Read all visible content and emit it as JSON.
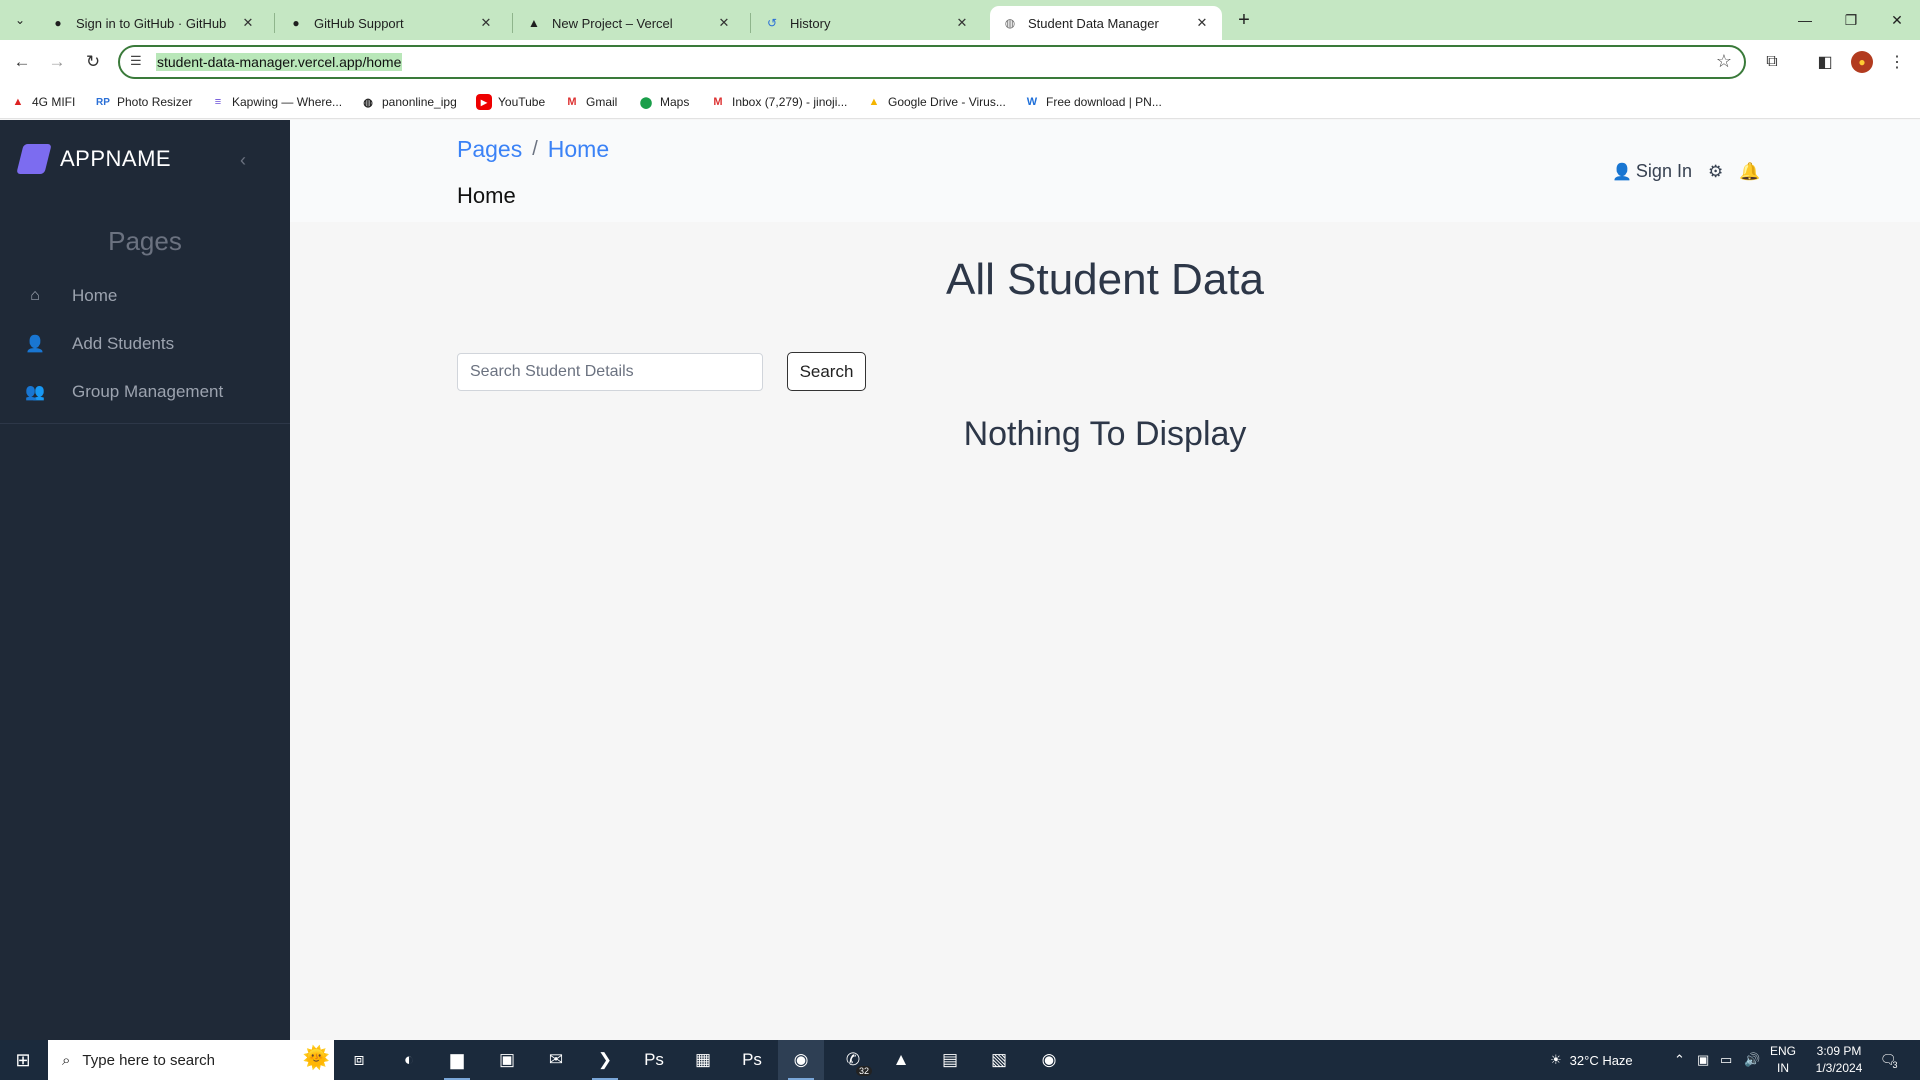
{
  "browser": {
    "tabs": [
      {
        "title": "Sign in to GitHub · GitHub",
        "icon": "github-icon"
      },
      {
        "title": "GitHub Support",
        "icon": "github-icon"
      },
      {
        "title": "New Project – Vercel",
        "icon": "vercel-icon"
      },
      {
        "title": "History",
        "icon": "history-icon"
      },
      {
        "title": "Student Data Manager",
        "icon": "globe-icon"
      }
    ],
    "active_tab": 4,
    "url": "student-data-manager.vercel.app/home",
    "bookmarks": [
      {
        "label": "4G MIFI"
      },
      {
        "label": "Photo Resizer"
      },
      {
        "label": "Kapwing — Where..."
      },
      {
        "label": "panonline_ipg"
      },
      {
        "label": "YouTube"
      },
      {
        "label": "Gmail"
      },
      {
        "label": "Maps"
      },
      {
        "label": "Inbox (7,279) - jinoji..."
      },
      {
        "label": "Google Drive - Virus..."
      },
      {
        "label": "Free download | PN..."
      }
    ]
  },
  "app": {
    "brand": "APPNAME",
    "sidebar": {
      "section_title": "Pages",
      "items": [
        {
          "label": "Home",
          "icon": "home-icon"
        },
        {
          "label": "Add Students",
          "icon": "add-user-icon"
        },
        {
          "label": "Group Management",
          "icon": "users-icon"
        }
      ]
    },
    "header": {
      "breadcrumb_root": "Pages",
      "breadcrumb_separator": "/",
      "breadcrumb_current": "Home",
      "page_title": "Home",
      "sign_in_label": "Sign In"
    },
    "main": {
      "heading": "All Student Data",
      "search_placeholder": "Search Student Details",
      "search_button": "Search",
      "empty_message": "Nothing To Display"
    },
    "colors": {
      "sidebar_bg": "#1f2937",
      "accent": "#3b82f6",
      "brand_logo": "#7c6cf0"
    }
  },
  "taskbar": {
    "search_placeholder": "Type here to search",
    "whatsapp_badge": "32",
    "weather": "32°C  Haze",
    "language": "ENG",
    "region": "IN",
    "time": "3:09 PM",
    "date": "1/3/2024",
    "notifications": "3"
  }
}
